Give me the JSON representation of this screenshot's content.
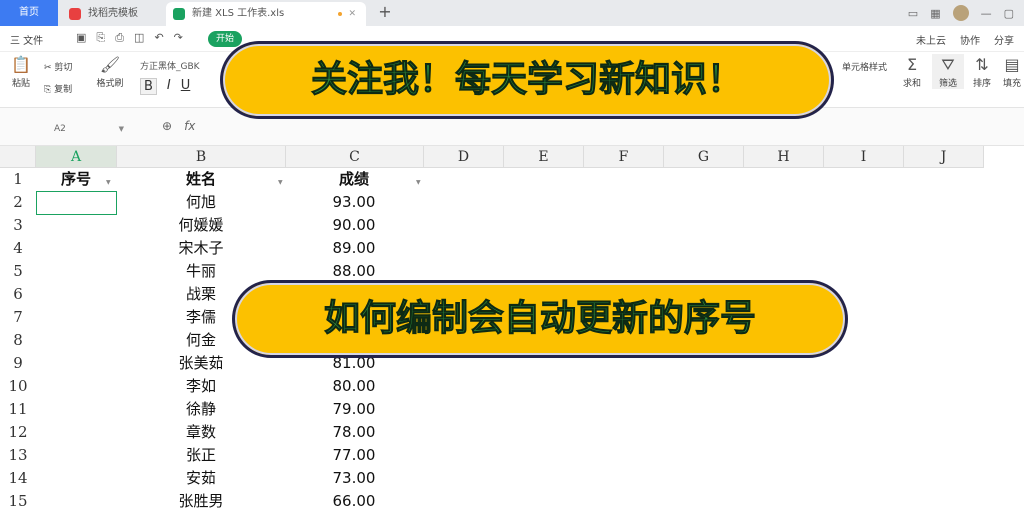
{
  "window": {
    "home_tab": "首页",
    "tabs": [
      {
        "label": "找稻壳模板",
        "icon": "docer-icon"
      },
      {
        "label": "新建 XLS 工作表.xls",
        "icon": "sheet-icon"
      }
    ],
    "new_tab": "+"
  },
  "menubar": {
    "file": "三 文件",
    "start_tab": "开始",
    "right_items": [
      "未上云",
      "协作",
      "分享"
    ]
  },
  "ribbon": {
    "paste": "粘贴",
    "cut": "剪切",
    "copy": "复制",
    "format_painter": "格式刷",
    "font_name": "方正黑体_GBK",
    "bold": "B",
    "italic": "I",
    "underline": "U",
    "cell_style": "单元格样式",
    "sum": "求和",
    "filter": "筛选",
    "sort": "排序",
    "fill": "填充"
  },
  "formula_bar": {
    "name_box": "A2",
    "fx": "fx"
  },
  "grid": {
    "columns": [
      "A",
      "B",
      "C",
      "D",
      "E",
      "F",
      "G",
      "H",
      "I",
      "J"
    ],
    "rows": [
      "1",
      "2",
      "3",
      "4",
      "5",
      "6",
      "7",
      "8",
      "9",
      "10",
      "11",
      "12",
      "13",
      "14",
      "15"
    ],
    "headers": {
      "a": "序号",
      "b": "姓名",
      "c": "成绩"
    },
    "names": [
      "何旭",
      "何媛媛",
      "宋木子",
      "牛丽",
      "战栗",
      "李儒",
      "何金",
      "张美茹",
      "李如",
      "徐静",
      "章数",
      "张正",
      "安茹",
      "张胜男"
    ],
    "scores": [
      "93.00",
      "90.00",
      "89.00",
      "88.00",
      "",
      "",
      "",
      "81.00",
      "80.00",
      "79.00",
      "78.00",
      "77.00",
      "73.00",
      "66.00"
    ]
  },
  "banners": {
    "top": "关注我！每天学习新知识！",
    "middle": "如何编制会自动更新的序号"
  }
}
